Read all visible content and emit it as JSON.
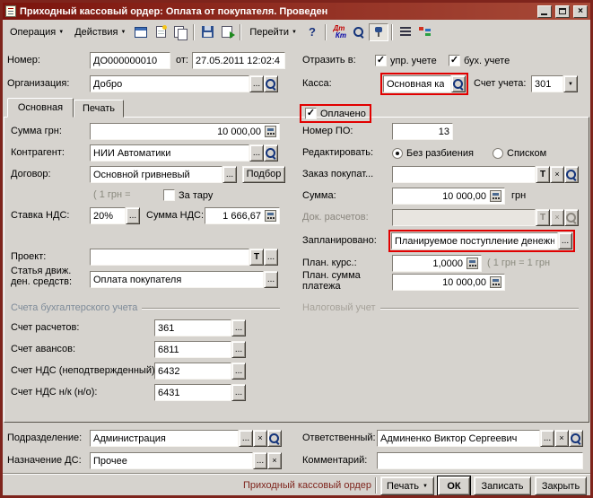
{
  "icons": {
    "close": "×",
    "check": "✓",
    "ellipsis": "...",
    "t": "T",
    "clear": "×",
    "arrow": "▼",
    "help": "?",
    "dt": "Дт",
    "kt": "Кт"
  },
  "window": {
    "title": "Приходный кассовый ордер: Оплата от покупателя. Проведен"
  },
  "toolbar": {
    "operation": "Операция",
    "actions": "Действия",
    "goto": "Перейти"
  },
  "header": {
    "number_label": "Номер:",
    "number_value": "ДО000000010",
    "date_label": "от:",
    "date_value": "27.05.2011 12:02:4",
    "org_label": "Организация:",
    "org_value": "Добро",
    "reflect_label": "Отразить в:",
    "cb_upr": "упр. учете",
    "cb_buh": "бух. учете",
    "kassa_label": "Касса:",
    "kassa_value": "Основная ка",
    "account_label": "Счет учета:",
    "account_value": "301"
  },
  "tabs": [
    {
      "label": "Основная"
    },
    {
      "label": "Печать"
    }
  ],
  "paid_label": "Оплачено",
  "left": {
    "summa_label": "Сумма грн:",
    "summa_value": "10 000,00",
    "kontragent_label": "Контрагент:",
    "kontragent_value": "НИИ Автоматики",
    "dogovor_label": "Договор:",
    "dogovor_value": "Основной гривневый",
    "podbor": "Подбор",
    "kurs_hint": "( 1 грн =",
    "za_taru": "За тару",
    "stavka_label": "Ставка НДС:",
    "stavka_value": "20%",
    "nds_label": "Сумма НДС:",
    "nds_value": "1 666,67",
    "proekt_label": "Проект:",
    "statya_label1": "Статья движ.",
    "statya_label2": "ден. средств:",
    "statya_value": "Оплата покупателя",
    "accounts_section": "Счета бухгалтерского учета",
    "acc1_label": "Счет расчетов:",
    "acc1_value": "361",
    "acc2_label": "Счет авансов:",
    "acc2_value": "6811",
    "acc3_label": "Счет НДС (неподтвержденный):",
    "acc3_value": "6432",
    "acc4_label": "Счет НДС н/к (н/о):",
    "acc4_value": "6431"
  },
  "right": {
    "po_label": "Номер ПО:",
    "po_value": "13",
    "edit_label": "Редактировать:",
    "radio1": "Без разбиения",
    "radio2": "Списком",
    "zakaz_label": "Заказ покупат...",
    "summa_label": "Сумма:",
    "summa_value": "10 000,00",
    "currency": "грн",
    "dok_label": "Док. расчетов:",
    "plan_label": "Запланировано:",
    "plan_value": "Планируемое поступление денежны",
    "kurs_label": "План. курс.:",
    "kurs_value": "1,0000",
    "kurs_hint": "( 1 грн = 1 грн",
    "plansum_label1": "План. сумма",
    "plansum_label2": "платежа",
    "plansum_value": "10 000,00",
    "tax_section": "Налоговый учет"
  },
  "bottom": {
    "podr_label": "Подразделение:",
    "podr_value": "Администрация",
    "nazn_label": "Назначение ДС:",
    "nazn_value": "Прочее",
    "otv_label": "Ответственный:",
    "otv_value": "Админенко Виктор Сергеевич",
    "comment_label": "Комментарий:"
  },
  "footer": {
    "doc_type": "Приходный кассовый ордер",
    "print": "Печать",
    "ok": "ОК",
    "save": "Записать",
    "close": "Закрыть"
  }
}
